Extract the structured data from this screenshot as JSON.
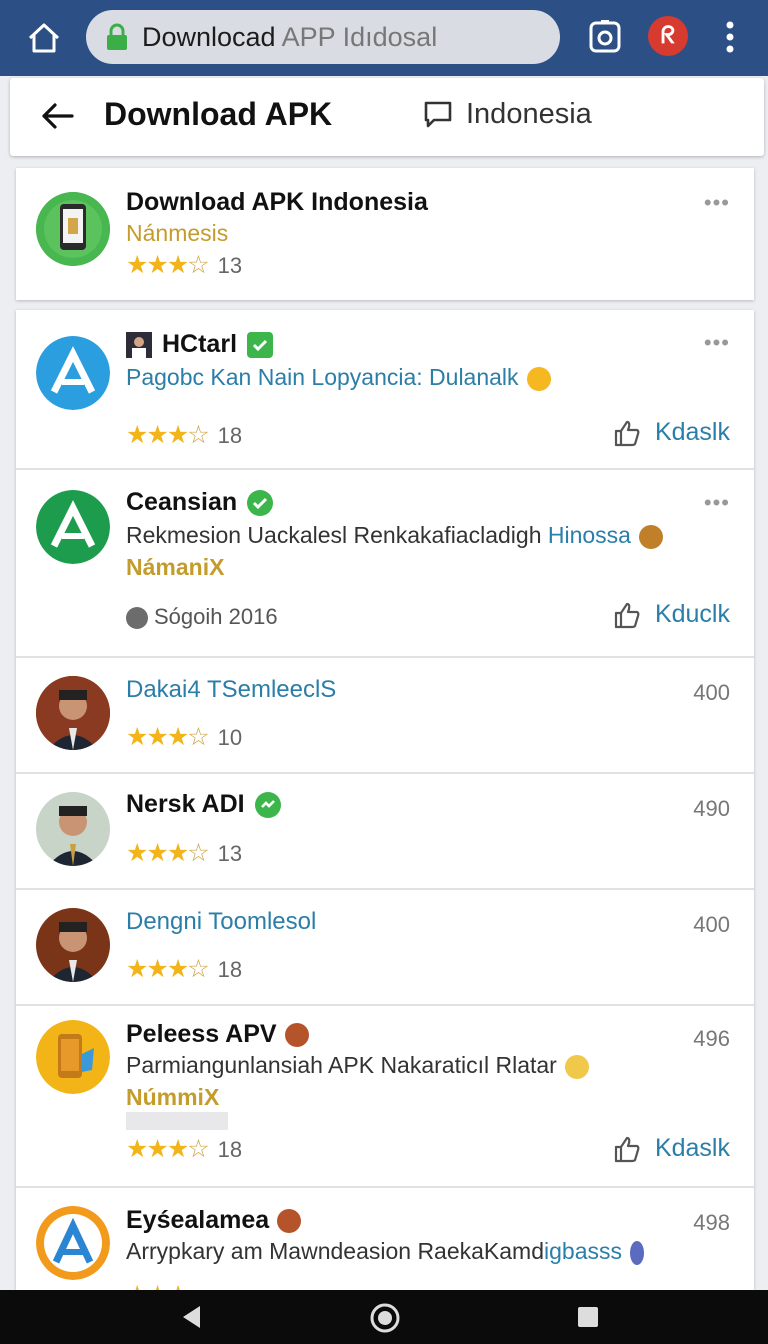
{
  "browser": {
    "url_main": "Downlocad",
    "url_rest": " APP Idıdosal",
    "badge_glyph": "ᖇ"
  },
  "header": {
    "title": "Download APK",
    "region": "Indonesia"
  },
  "featured": {
    "name": "Download APK Indonesia",
    "developer": "Nánmesis",
    "rating_count": "13",
    "more": "•••"
  },
  "apps": [
    {
      "name": "HCtarl",
      "description": "Pagobc Kan Nain Lopyancia: Dulanalk",
      "rating_count": "18",
      "action": "Kdaslk",
      "more": "•••"
    },
    {
      "name": "Ceansian",
      "description_dark": "Rekmesion Uackalesl Renkakafiacladigh",
      "description_blue": " Hinossa",
      "developer": "NámaniX",
      "meta": "Sógoih 2016",
      "action": "Kduclk",
      "more": "•••"
    },
    {
      "name": "Dakai4 TSemleeclS",
      "rating_count": "10",
      "number": "400"
    },
    {
      "name": "Nersk ADI",
      "rating_count": "13",
      "number": "490"
    },
    {
      "name": "Dengni Toomlesol",
      "rating_count": "18",
      "number": "400"
    },
    {
      "name": "Peleess APV",
      "description": "Parmiangunlansiah APK Nakaraticıl Rlatar",
      "developer": "NúmmiX",
      "rating_count": "18",
      "number": "496",
      "action": "Kdaslk"
    },
    {
      "name": "Eyśealamea",
      "description_dark": "Arrypkary am Mawndeasion RaekaKamd",
      "description_blue": "igbasss",
      "number": "498"
    }
  ],
  "colors": {
    "topbar": "#2c4f86",
    "accent_link": "#2a7ea8",
    "star": "#f2b418",
    "verified": "#3cb54a"
  }
}
